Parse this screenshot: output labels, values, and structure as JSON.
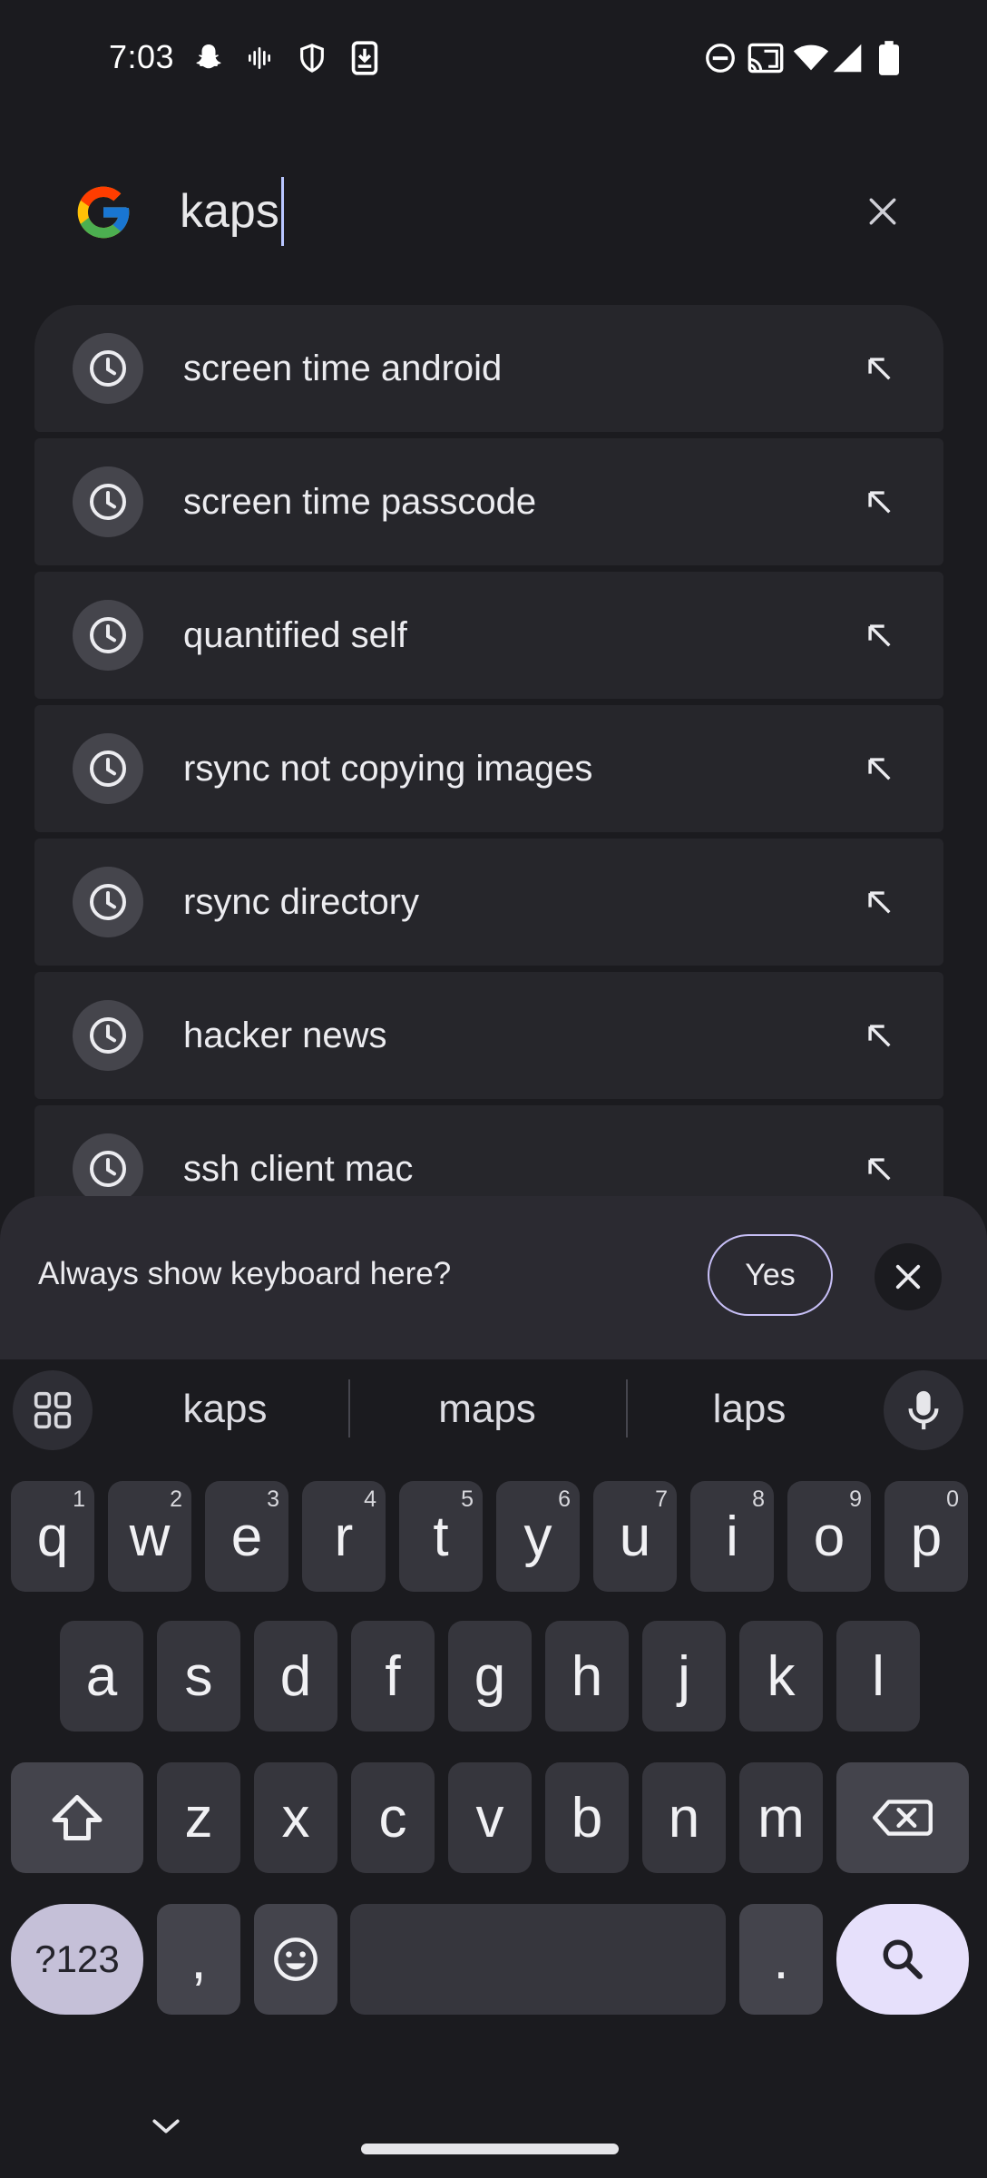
{
  "status_bar": {
    "time": "7:03",
    "left_icons": [
      "snapchat-icon",
      "audio-waveform-icon",
      "vpn-shield-icon",
      "download-icon"
    ],
    "right_icons": [
      "do-not-disturb-icon",
      "cast-icon",
      "wifi-icon",
      "signal-icon",
      "battery-icon"
    ]
  },
  "search": {
    "query": "kaps",
    "logo": "google-logo",
    "clear_icon": "close-icon"
  },
  "suggestions": [
    {
      "label": "screen time android"
    },
    {
      "label": "screen time passcode"
    },
    {
      "label": "quantified self"
    },
    {
      "label": "rsync not copying images"
    },
    {
      "label": "rsync directory"
    },
    {
      "label": "hacker news"
    },
    {
      "label": "ssh client mac"
    }
  ],
  "keyboard_prompt": {
    "text": "Always show keyboard here?",
    "yes_label": "Yes"
  },
  "keyboard": {
    "suggestions": [
      "kaps",
      "maps",
      "laps"
    ],
    "row1": [
      {
        "k": "q",
        "h": "1"
      },
      {
        "k": "w",
        "h": "2"
      },
      {
        "k": "e",
        "h": "3"
      },
      {
        "k": "r",
        "h": "4"
      },
      {
        "k": "t",
        "h": "5"
      },
      {
        "k": "y",
        "h": "6"
      },
      {
        "k": "u",
        "h": "7"
      },
      {
        "k": "i",
        "h": "8"
      },
      {
        "k": "o",
        "h": "9"
      },
      {
        "k": "p",
        "h": "0"
      }
    ],
    "row2": [
      "a",
      "s",
      "d",
      "f",
      "g",
      "h",
      "j",
      "k",
      "l"
    ],
    "row3": [
      "z",
      "x",
      "c",
      "v",
      "b",
      "n",
      "m"
    ],
    "symbols_label": "?123",
    "comma_label": ",",
    "period_label": "."
  },
  "colors": {
    "background": "#1b1b1f",
    "suggestion_bg": "#26262b",
    "key_bg": "#36363d",
    "accent": "#e6e0fb"
  }
}
